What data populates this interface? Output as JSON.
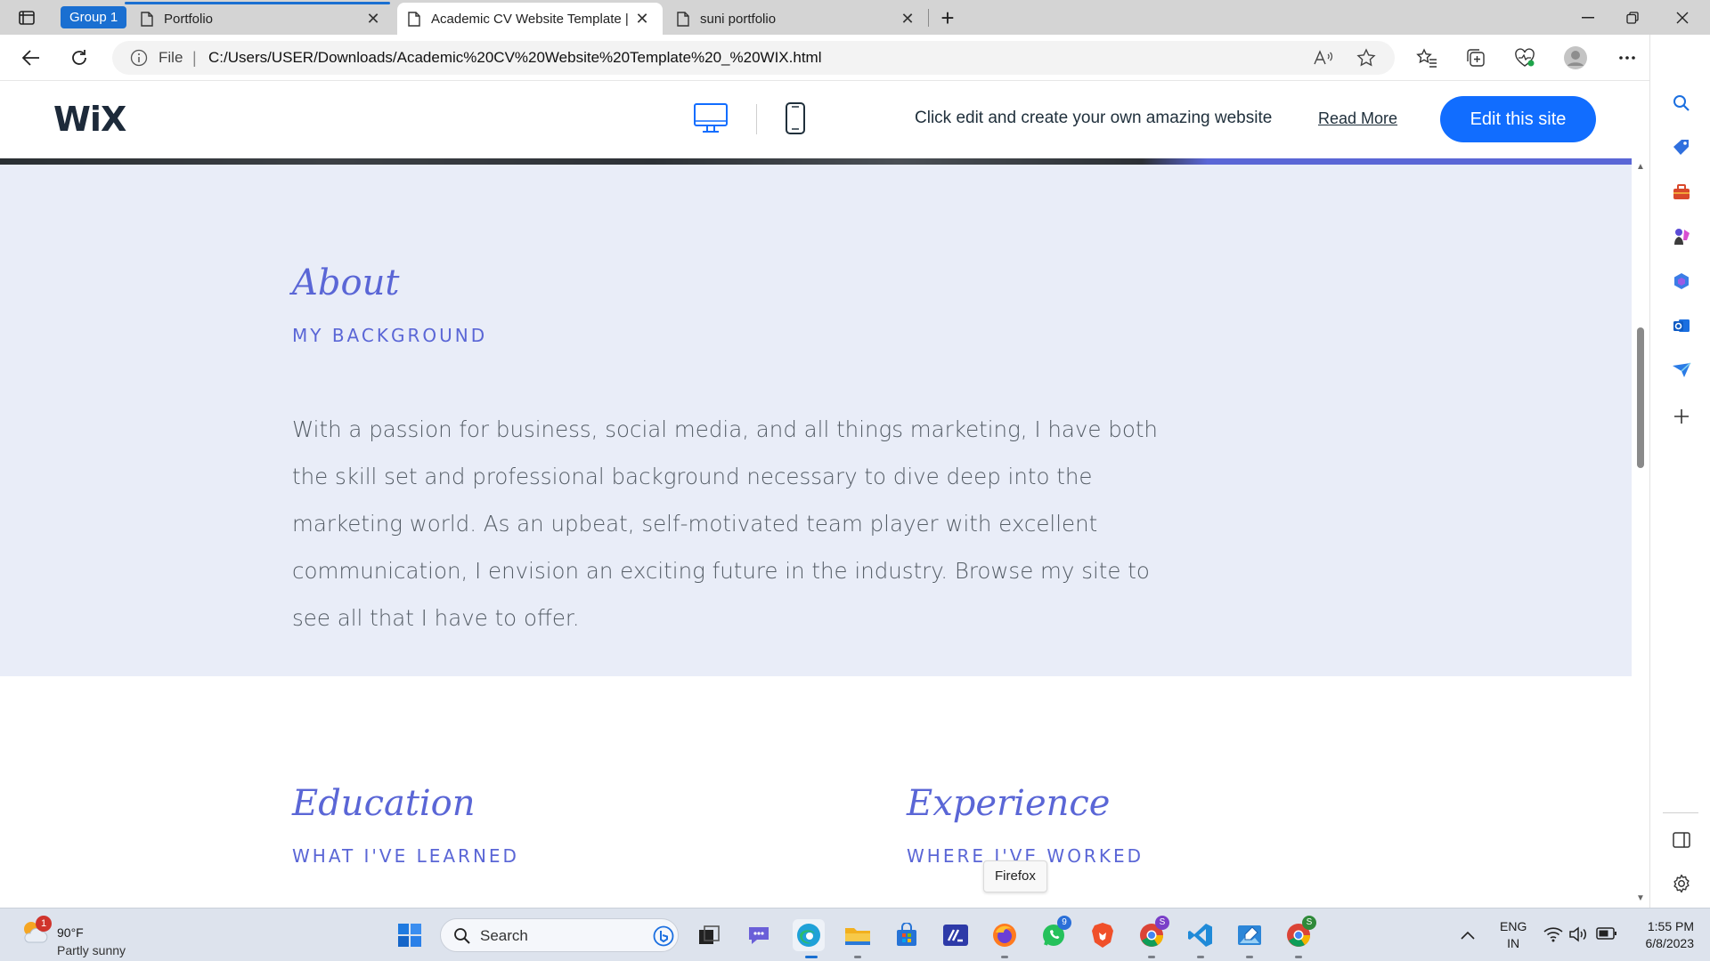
{
  "browser": {
    "tab_group_label": "Group 1",
    "tabs": [
      {
        "title": "Portfolio"
      },
      {
        "title": "Academic CV Website Template |"
      },
      {
        "title": "suni portfolio"
      }
    ],
    "address": {
      "scheme_label": "File",
      "url": "C:/Users/USER/Downloads/Academic%20CV%20Website%20Template%20_%20WIX.html"
    }
  },
  "wix_banner": {
    "logo": "WiX",
    "promo_text": "Click edit and create your own amazing website",
    "read_more": "Read More",
    "edit_button": "Edit this site"
  },
  "page": {
    "about": {
      "title": "About",
      "subtitle": "MY BACKGROUND",
      "body": "With a passion for business, social media, and all things marketing, I have both the skill set and professional background necessary to dive deep into the marketing world. As an upbeat, self-motivated team player with excellent communication, I envision an exciting future in the industry. Browse my site to see all that I have to offer."
    },
    "education": {
      "title": "Education",
      "subtitle": "WHAT I'VE LEARNED"
    },
    "experience": {
      "title": "Experience",
      "subtitle": "WHERE I'VE WORKED"
    },
    "accent_color": "#5a66d6",
    "about_background": "#e9edf8"
  },
  "tooltip": "Firefox",
  "taskbar": {
    "weather": {
      "temp": "90°F",
      "desc": "Partly sunny",
      "badge": "1"
    },
    "search_placeholder": "Search",
    "badges": {
      "whatsapp": "9",
      "chrome_profile_1": "S",
      "chrome_profile_2": "S"
    },
    "tray": {
      "lang_1": "ENG",
      "lang_2": "IN",
      "time": "1:55 PM",
      "date": "6/8/2023"
    }
  }
}
